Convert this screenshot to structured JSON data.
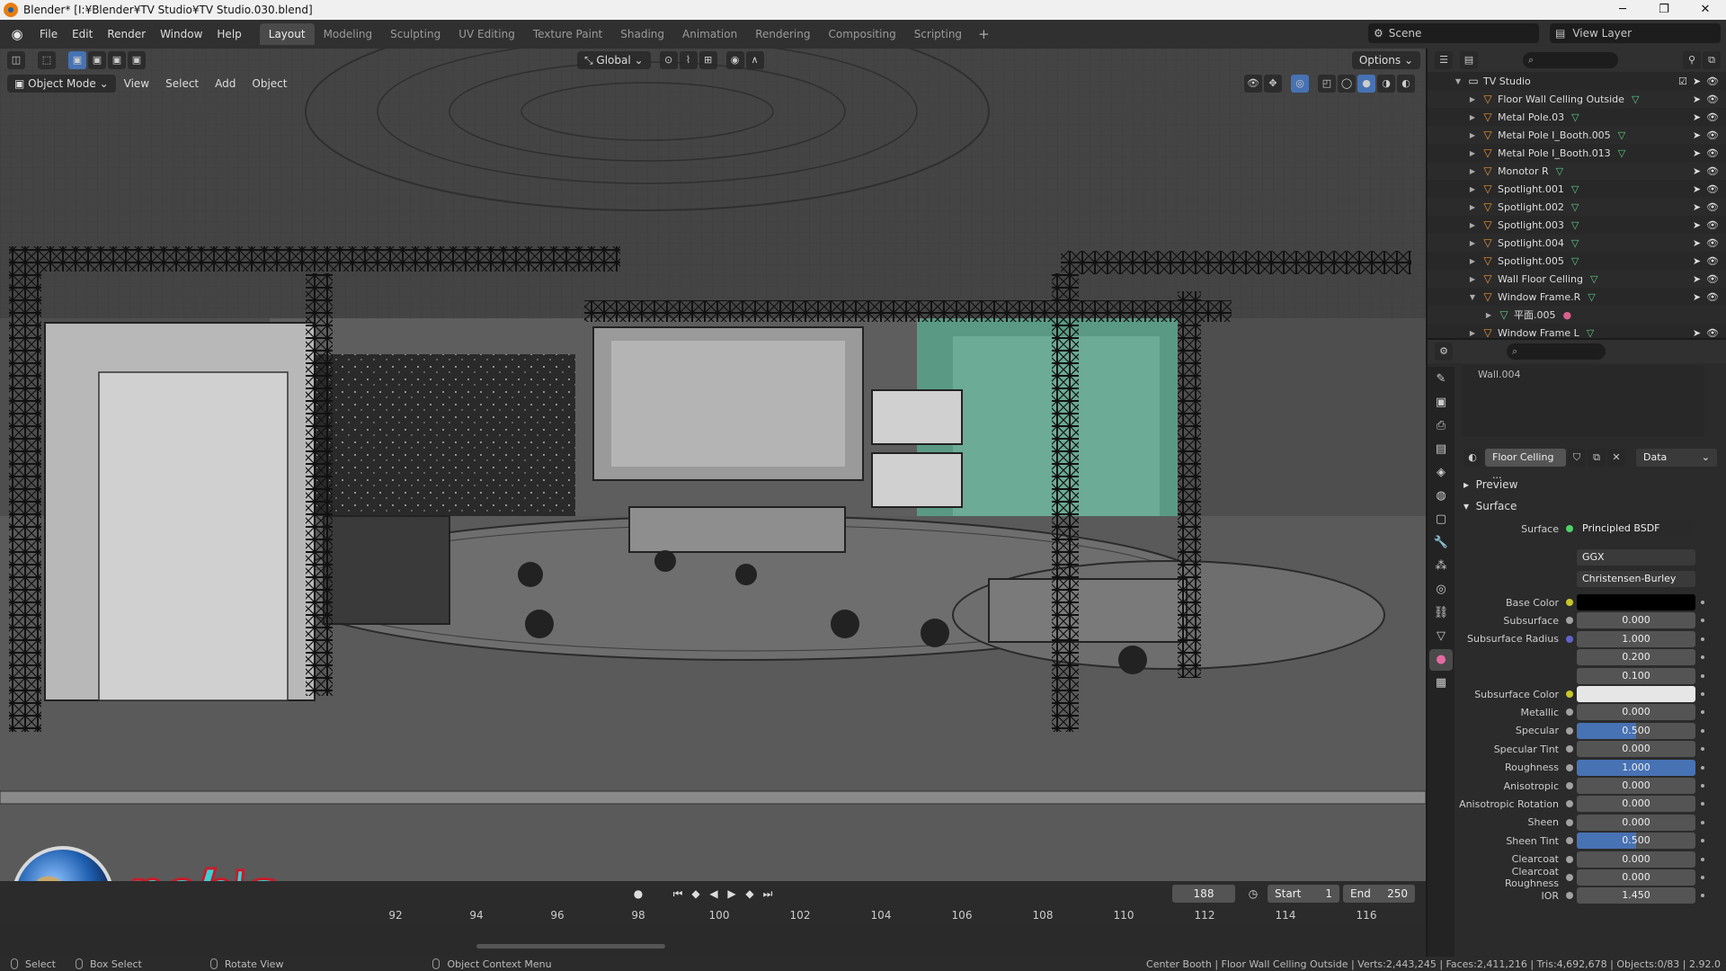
{
  "window": {
    "title": "Blender* [I:¥Blender¥TV Studio¥TV Studio.030.blend]",
    "controls": [
      "─",
      "❐",
      "✕"
    ]
  },
  "menu": [
    "File",
    "Edit",
    "Render",
    "Window",
    "Help"
  ],
  "workspaces": [
    {
      "label": "Layout",
      "active": true
    },
    {
      "label": "Modeling"
    },
    {
      "label": "Sculpting"
    },
    {
      "label": "UV Editing"
    },
    {
      "label": "Texture Paint"
    },
    {
      "label": "Shading"
    },
    {
      "label": "Animation"
    },
    {
      "label": "Rendering"
    },
    {
      "label": "Compositing"
    },
    {
      "label": "Scripting"
    }
  ],
  "scene_name": "Scene",
  "view_layer": "View Layer",
  "viewport": {
    "transform_orientation": "Global",
    "options_label": "Options",
    "mode": "Object Mode",
    "menus": [
      "View",
      "Select",
      "Add",
      "Object"
    ]
  },
  "timeline": {
    "current_frame": "188",
    "start_label": "Start",
    "start_value": "1",
    "end_label": "End",
    "end_value": "250",
    "ruler": [
      "92",
      "94",
      "96",
      "98",
      "100",
      "102",
      "104",
      "106",
      "108",
      "110",
      "112",
      "114",
      "116"
    ]
  },
  "watermark_text": "nob's factory",
  "statusbar": {
    "select": "Select",
    "box_select": "Box Select",
    "rotate_view": "Rotate View",
    "context_menu": "Object Context Menu",
    "stats": "Center Booth | Floor Wall Celling Outside | Verts:2,443,245 | Faces:2,411,216 | Tris:4,692,678 | Objects:0/83 | 2.92.0"
  },
  "outliner": {
    "collection": "TV Studio",
    "items": [
      {
        "label": "Floor Wall Celling Outside",
        "expanded": false,
        "child": false
      },
      {
        "label": "Metal Pole.03",
        "expanded": false,
        "child": false
      },
      {
        "label": "Metal Pole I_Booth.005",
        "expanded": false,
        "child": false
      },
      {
        "label": "Metal Pole I_Booth.013",
        "expanded": false,
        "child": false
      },
      {
        "label": "Monotor R",
        "expanded": false,
        "child": false
      },
      {
        "label": "Spotlight.001",
        "expanded": false,
        "child": false
      },
      {
        "label": "Spotlight.002",
        "expanded": false,
        "child": false
      },
      {
        "label": "Spotlight.003",
        "expanded": false,
        "child": false
      },
      {
        "label": "Spotlight.004",
        "expanded": false,
        "child": false
      },
      {
        "label": "Spotlight.005",
        "expanded": false,
        "child": false
      },
      {
        "label": "Wall Floor Celling",
        "expanded": false,
        "child": false
      },
      {
        "label": "Window Frame.R",
        "expanded": true,
        "child": false
      },
      {
        "label": "平面.005",
        "expanded": false,
        "child": true
      },
      {
        "label": "Window Frame L",
        "expanded": false,
        "child": false
      }
    ]
  },
  "properties": {
    "slot_item": "Wall.004",
    "material_name": "Floor Celling ...",
    "link_mode": "Data",
    "preview_label": "Preview",
    "surface_panel": "Surface",
    "surface_label": "Surface",
    "surface_shader": "Principled BSDF",
    "distribution": "GGX",
    "subsurface_method": "Christensen-Burley",
    "rows": [
      {
        "label": "Base Color",
        "value": "",
        "kind": "color",
        "color": "#000000",
        "socket": "#c7c729"
      },
      {
        "label": "Subsurface",
        "value": "0.000",
        "kind": "num",
        "fill": 0
      },
      {
        "label": "Subsurface Radius",
        "value": "1.000",
        "kind": "num",
        "fill": 0,
        "socket": "#6363c7"
      },
      {
        "label": "",
        "value": "0.200",
        "kind": "num",
        "fill": 0,
        "nosock": true
      },
      {
        "label": "",
        "value": "0.100",
        "kind": "num",
        "fill": 0,
        "nosock": true
      },
      {
        "label": "Subsurface Color",
        "value": "",
        "kind": "color",
        "color": "#e6e6e6",
        "socket": "#c7c729"
      },
      {
        "label": "Metallic",
        "value": "0.000",
        "kind": "num",
        "fill": 0
      },
      {
        "label": "Specular",
        "value": "0.500",
        "kind": "num",
        "fill": 0.5
      },
      {
        "label": "Specular Tint",
        "value": "0.000",
        "kind": "num",
        "fill": 0
      },
      {
        "label": "Roughness",
        "value": "1.000",
        "kind": "num",
        "fill": 1
      },
      {
        "label": "Anisotropic",
        "value": "0.000",
        "kind": "num",
        "fill": 0
      },
      {
        "label": "Anisotropic Rotation",
        "value": "0.000",
        "kind": "num",
        "fill": 0
      },
      {
        "label": "Sheen",
        "value": "0.000",
        "kind": "num",
        "fill": 0
      },
      {
        "label": "Sheen Tint",
        "value": "0.500",
        "kind": "num",
        "fill": 0.5
      },
      {
        "label": "Clearcoat",
        "value": "0.000",
        "kind": "num",
        "fill": 0
      },
      {
        "label": "Clearcoat Roughness",
        "value": "0.000",
        "kind": "num",
        "fill": 0
      },
      {
        "label": "IOR",
        "value": "1.450",
        "kind": "num",
        "fill": 0
      }
    ]
  },
  "colors": {
    "accent": "#4772b3",
    "object_icon": "#e8963a",
    "mesh_icon": "#5fc88c",
    "watermark_fill": "#39d1d6",
    "watermark_outline": "#c61d2a"
  }
}
